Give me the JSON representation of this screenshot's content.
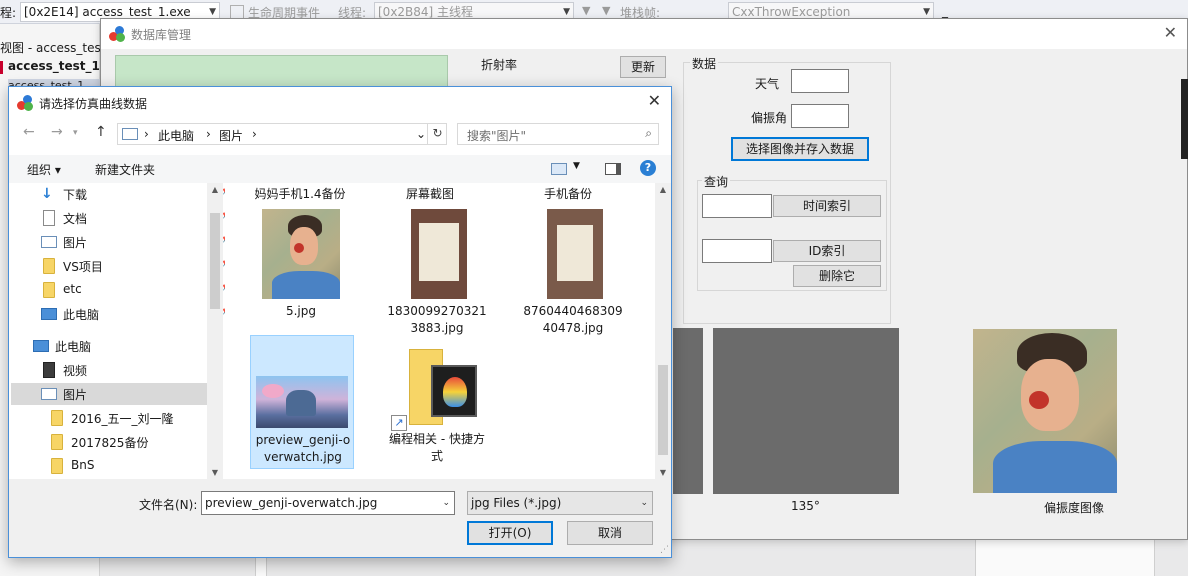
{
  "vs": {
    "left_label": "程:",
    "process": "[0x2E14] access_test_1.exe",
    "lifecycle_label": "生命周期事件",
    "thread_label": "线程:",
    "thread": "[0x2B84] 主线程",
    "stack_label": "堆栈帧:",
    "stack": "CxxThrowException",
    "view_text": "视图 - access_test_",
    "project_name": "access_test_1",
    "partial_text": "access_test_1",
    "underscore": "_"
  },
  "db_window": {
    "title": "数据库管理",
    "close": "✕",
    "refraction_label": "折射率",
    "update_button": "更新",
    "data_group": "数据",
    "weather_label": "天气",
    "polar_angle_label": "偏振角",
    "select_store_button": "选择图像并存入数据",
    "query_group": "查询",
    "time_index_button": "时间索引",
    "id_index_button": "ID索引",
    "delete_button": "删除它",
    "angle_label": "135°",
    "polar_image_label": "偏振度图像"
  },
  "file_dialog": {
    "title": "请选择仿真曲线数据",
    "close": "✕",
    "nav": {
      "back": "←",
      "forward": "→",
      "up": "↑",
      "refresh": "↻"
    },
    "breadcrumb": [
      "此电脑",
      "图片"
    ],
    "search_placeholder": "搜索\"图片\"",
    "organize": "组织 ▾",
    "new_folder": "新建文件夹",
    "help": "?",
    "sidebar": [
      {
        "label": "下载",
        "icon": "download-icon",
        "pinned": true
      },
      {
        "label": "文档",
        "icon": "document-icon",
        "pinned": true
      },
      {
        "label": "图片",
        "icon": "pictures-icon",
        "pinned": true
      },
      {
        "label": "VS项目",
        "icon": "folder-icon",
        "pinned": true
      },
      {
        "label": "etc",
        "icon": "folder-icon",
        "pinned": true
      },
      {
        "label": "此电脑",
        "icon": "computer-icon",
        "pinned": true
      },
      {
        "label": "此电脑",
        "icon": "computer-icon",
        "pinned": false
      },
      {
        "label": "视频",
        "icon": "video-icon",
        "pinned": false
      },
      {
        "label": "图片",
        "icon": "pictures-icon",
        "pinned": false,
        "selected": true
      },
      {
        "label": "2016_五一_刘一隆",
        "icon": "folder-icon",
        "pinned": false
      },
      {
        "label": "2017825备份",
        "icon": "folder-icon",
        "pinned": false
      },
      {
        "label": "BnS",
        "icon": "folder-icon",
        "pinned": false
      }
    ],
    "pin_symbol": "📌",
    "group_headers": [
      "妈妈手机1.4备份",
      "屏幕截图",
      "手机备份"
    ],
    "files": [
      {
        "name": "5.jpg",
        "type": "portrait"
      },
      {
        "name": "18300992703213883.jpg",
        "type": "document"
      },
      {
        "name": "876044046830940478.jpg",
        "type": "document"
      },
      {
        "name": "preview_genji-overwatch.jpg",
        "type": "game",
        "selected": true
      },
      {
        "name": "编程相关 - 快捷方式",
        "type": "shortcut"
      }
    ],
    "filename_label": "文件名(N):",
    "filename_value": "preview_genji-overwatch.jpg",
    "filter_value": "jpg Files (*.jpg)",
    "open_button": "打开(O)",
    "cancel_button": "取消"
  }
}
